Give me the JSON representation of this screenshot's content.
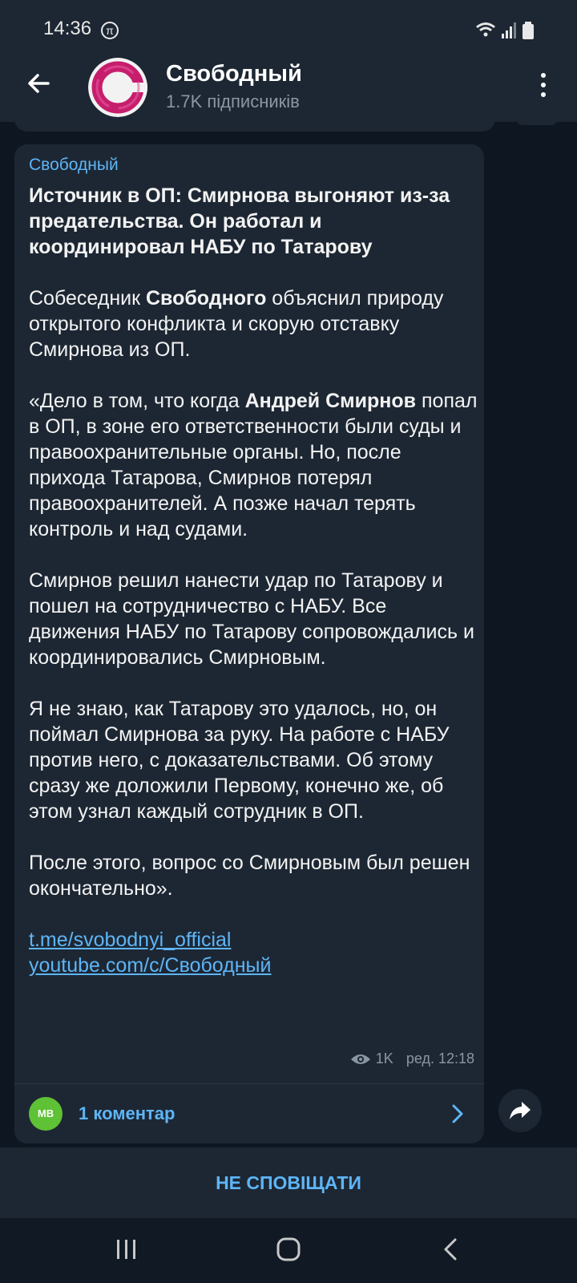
{
  "status_bar": {
    "time": "14:36",
    "pi_glyph": "π",
    "icons": [
      "wifi-icon",
      "signal-icon",
      "battery-icon"
    ]
  },
  "header": {
    "title": "Свободный",
    "subscribers": "1.7K підписників",
    "back_icon": "arrow-left-icon",
    "menu_icon": "more-vertical-icon"
  },
  "message": {
    "author": "Свободный",
    "headline": "Источник в ОП: Смирнова выгоняют из-за предательства. Он работал и координировал НАБУ по Татарову",
    "p1_a": "Собеседник ",
    "p1_bold": "Свободного",
    "p1_b": " объяснил природу открытого конфликта и скорую отставку Смирнова из ОП.",
    "p2_a": "«Дело в том, что когда ",
    "p2_bold": "Андрей Смирнов",
    "p2_b": " попал в ОП, в зоне его ответственности были суды и правоохранительные органы. Но, после прихода Татарова, Смирнов потерял правоохранителей. А позже начал терять контроль и над судами.",
    "p3": "Смирнов решил нанести удар по Татарову и пошел на сотрудничество с НАБУ. Все движения НАБУ по Татарову сопровождались и координировались Смирновым.",
    "p4": "Я не знаю, как Татарову это удалось, но, он поймал Смирнова за руку. На работе с НАБУ против него, с доказательствами. Об этому сразу же доложили Первому, конечно же, об этом узнал каждый сотрудник в ОП.",
    "p5": "После этого, вопрос со Смирновым был решен окончательно».",
    "link1": "t.me/svobodnyi_official",
    "link2": "youtube.com/c/Свободный",
    "views": "1K",
    "edited_time": "ред. 12:18"
  },
  "comments": {
    "avatar_initials": "МВ",
    "label": "1 коментар"
  },
  "bottom": {
    "mute_label": "НЕ СПОВІЩАТИ"
  },
  "colors": {
    "background": "#0e1621",
    "surface": "#1d2733",
    "accent": "#5eb5f7",
    "muted_text": "#8a96a3",
    "comment_avatar": "#5fc135"
  }
}
